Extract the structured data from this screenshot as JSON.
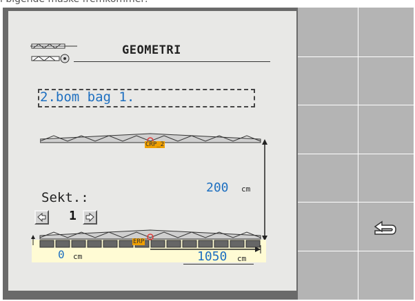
{
  "caption": "i bigende maske fremkommer:",
  "screen": {
    "title": "GEOMETRI",
    "boom_name": "2.bom bag 1.",
    "crp_label": "CRP_2",
    "erp_label": "ERP",
    "distance_value": "200",
    "distance_unit": "cm",
    "section_label": "Sekt.:",
    "section_value": "1",
    "left_offset_value": "0",
    "left_offset_unit": "cm",
    "width_value": "1050",
    "width_unit": "cm"
  },
  "softkeys": {
    "back_icon": "return-arrow-icon"
  },
  "colors": {
    "value_blue": "#1d6fc0",
    "screen_bg": "#e8e8e6",
    "softkey_bg": "#b4b4b4",
    "highlight_yellow": "#fffbd4",
    "marker_orange": "#f0a000"
  }
}
